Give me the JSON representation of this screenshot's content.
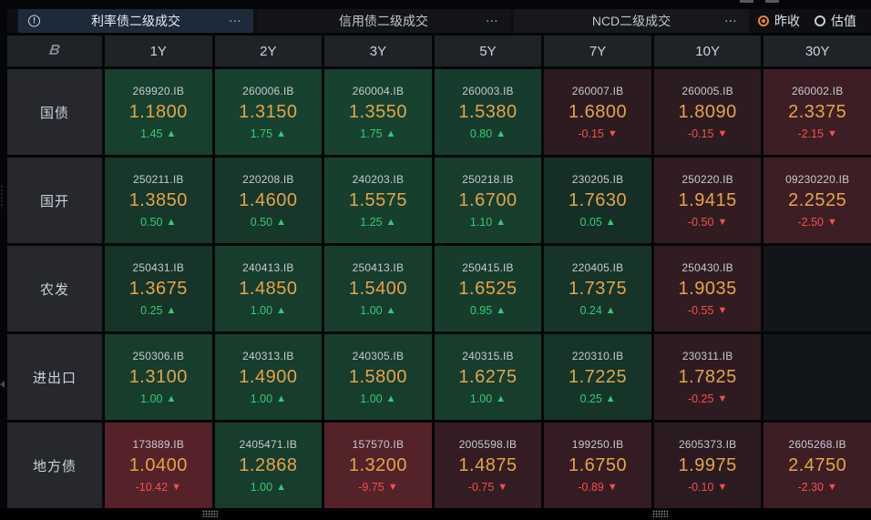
{
  "header_bar": {
    "tabs": [
      {
        "label": "利率债二级成交",
        "active": true
      },
      {
        "label": "信用债二级成交",
        "active": false
      },
      {
        "label": "NCD二级成交",
        "active": false
      }
    ],
    "radio_group": [
      {
        "label": "昨收",
        "selected": true
      },
      {
        "label": "估值",
        "selected": false
      }
    ]
  },
  "icons": {
    "info": "!",
    "menu_dots": "⋯",
    "up_arrow": "▲",
    "down_arrow": "▼"
  },
  "table": {
    "corner_logo": "B",
    "columns": [
      "1Y",
      "2Y",
      "3Y",
      "5Y",
      "7Y",
      "10Y",
      "30Y"
    ],
    "rows": [
      {
        "label": "国债",
        "cells": [
          {
            "code": "269920.IB",
            "value": "1.1800",
            "chg": "1.45"
          },
          {
            "code": "260006.IB",
            "value": "1.3150",
            "chg": "1.75"
          },
          {
            "code": "260004.IB",
            "value": "1.3550",
            "chg": "1.75"
          },
          {
            "code": "260003.IB",
            "value": "1.5380",
            "chg": "0.80"
          },
          {
            "code": "260007.IB",
            "value": "1.6800",
            "chg": "-0.15"
          },
          {
            "code": "260005.IB",
            "value": "1.8090",
            "chg": "-0.15"
          },
          {
            "code": "260002.IB",
            "value": "2.3375",
            "chg": "-2.15"
          }
        ]
      },
      {
        "label": "国开",
        "cells": [
          {
            "code": "250211.IB",
            "value": "1.3850",
            "chg": "0.50"
          },
          {
            "code": "220208.IB",
            "value": "1.4600",
            "chg": "0.50"
          },
          {
            "code": "240203.IB",
            "value": "1.5575",
            "chg": "1.25"
          },
          {
            "code": "250218.IB",
            "value": "1.6700",
            "chg": "1.10"
          },
          {
            "code": "230205.IB",
            "value": "1.7630",
            "chg": "0.05"
          },
          {
            "code": "250220.IB",
            "value": "1.9415",
            "chg": "-0.50"
          },
          {
            "code": "09230220.IB",
            "value": "2.2525",
            "chg": "-2.50"
          }
        ]
      },
      {
        "label": "农发",
        "cells": [
          {
            "code": "250431.IB",
            "value": "1.3675",
            "chg": "0.25"
          },
          {
            "code": "240413.IB",
            "value": "1.4850",
            "chg": "1.00"
          },
          {
            "code": "250413.IB",
            "value": "1.5400",
            "chg": "1.00"
          },
          {
            "code": "250415.IB",
            "value": "1.6525",
            "chg": "0.95"
          },
          {
            "code": "220405.IB",
            "value": "1.7375",
            "chg": "0.24"
          },
          {
            "code": "250430.IB",
            "value": "1.9035",
            "chg": "-0.55"
          },
          null
        ]
      },
      {
        "label": "进出口",
        "cells": [
          {
            "code": "250306.IB",
            "value": "1.3100",
            "chg": "1.00"
          },
          {
            "code": "240313.IB",
            "value": "1.4900",
            "chg": "1.00"
          },
          {
            "code": "240305.IB",
            "value": "1.5800",
            "chg": "1.00"
          },
          {
            "code": "240315.IB",
            "value": "1.6275",
            "chg": "1.00"
          },
          {
            "code": "220310.IB",
            "value": "1.7225",
            "chg": "0.25"
          },
          {
            "code": "230311.IB",
            "value": "1.7825",
            "chg": "-0.25"
          },
          null
        ]
      },
      {
        "label": "地方债",
        "cells": [
          {
            "code": "173889.IB",
            "value": "1.0400",
            "chg": "-10.42"
          },
          {
            "code": "2405471.IB",
            "value": "1.2868",
            "chg": "1.00"
          },
          {
            "code": "157570.IB",
            "value": "1.3200",
            "chg": "-9.75"
          },
          {
            "code": "2005598.IB",
            "value": "1.4875",
            "chg": "-0.75"
          },
          {
            "code": "199250.IB",
            "value": "1.6750",
            "chg": "-0.89"
          },
          {
            "code": "2605373.IB",
            "value": "1.9975",
            "chg": "-0.10"
          },
          {
            "code": "2605268.IB",
            "value": "2.4750",
            "chg": "-2.30"
          }
        ]
      }
    ]
  },
  "colors": {
    "accent_orange": "#e4a44a",
    "up_green": "#35cc74",
    "down_red": "#f4504e",
    "active_tab_bg": "#1d2a3a",
    "radio_orange": "#e8862e"
  }
}
